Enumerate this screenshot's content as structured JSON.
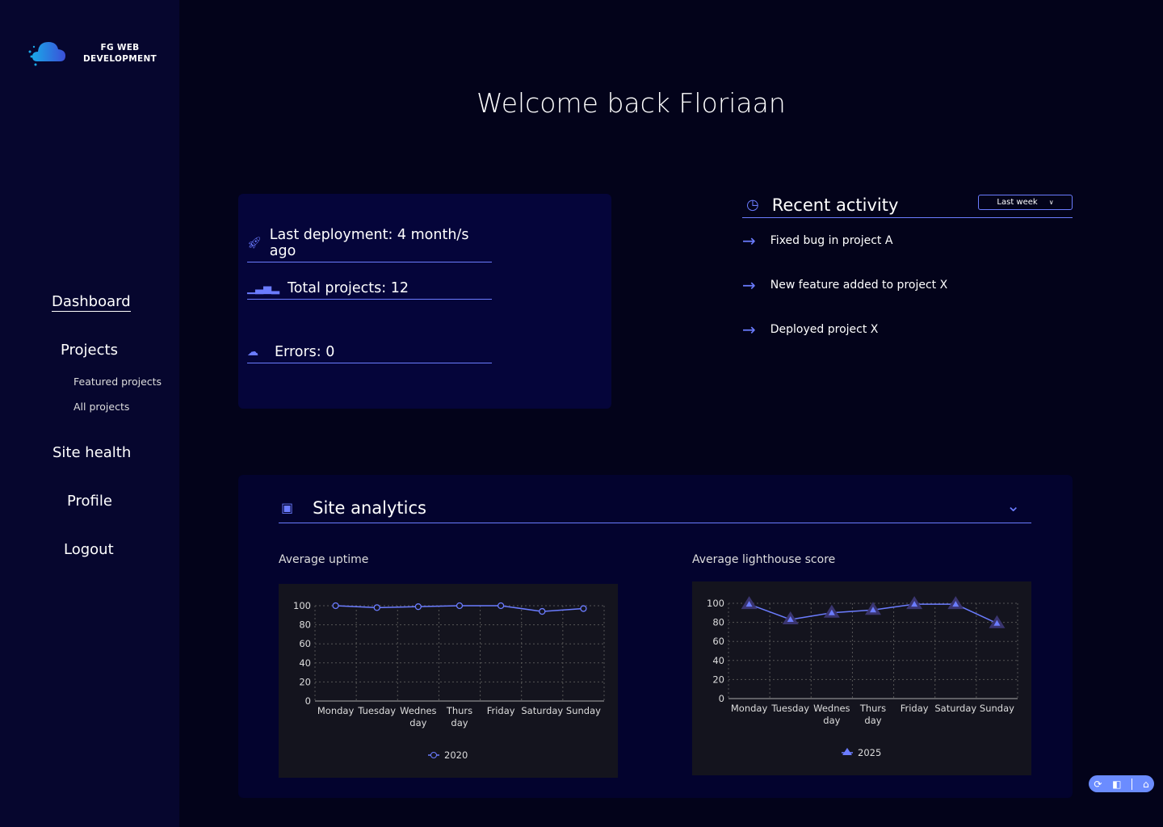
{
  "brand": {
    "line1": "FG WEB",
    "line2": "DEVELOPMENT"
  },
  "nav": {
    "dashboard": "Dashboard",
    "projects": "Projects",
    "featured": "Featured projects",
    "all": "All projects",
    "site_health": "Site health",
    "profile": "Profile",
    "logout": "Logout"
  },
  "welcome": "Welcome back Floriaan",
  "stats": {
    "deployment": "Last deployment: 4 month/s ago",
    "projects": "Total projects: 12",
    "errors": "Errors: 0"
  },
  "recent": {
    "title": "Recent activity",
    "filter": "Last week",
    "items": [
      "Fixed bug in project A",
      "New feature added to project X",
      "Deployed project X"
    ]
  },
  "analytics": {
    "title": "Site analytics"
  },
  "accent": "#6b7cff",
  "chart_data": [
    {
      "type": "line",
      "title": "Average uptime",
      "categories": [
        "Monday",
        "Tuesday",
        "Wednes day",
        "Thurs day",
        "Friday",
        "Saturday",
        "Sunday"
      ],
      "series": [
        {
          "name": "2020",
          "values": [
            100,
            98,
            99,
            100,
            100,
            94,
            97
          ]
        }
      ],
      "ylim": [
        0,
        100
      ],
      "yticks": [
        0,
        20,
        40,
        60,
        80,
        100
      ],
      "grid": true,
      "legend": "bottom",
      "marker": "circle"
    },
    {
      "type": "line",
      "title": "Average lighthouse score",
      "categories": [
        "Monday",
        "Tuesday",
        "Wednes day",
        "Thurs day",
        "Friday",
        "Saturday",
        "Sunday"
      ],
      "series": [
        {
          "name": "2025",
          "values": [
            99,
            83,
            90,
            93,
            99,
            99,
            79
          ]
        }
      ],
      "ylim": [
        0,
        100
      ],
      "yticks": [
        0,
        20,
        40,
        60,
        80,
        100
      ],
      "grid": true,
      "legend": "bottom",
      "marker": "triangle"
    }
  ]
}
